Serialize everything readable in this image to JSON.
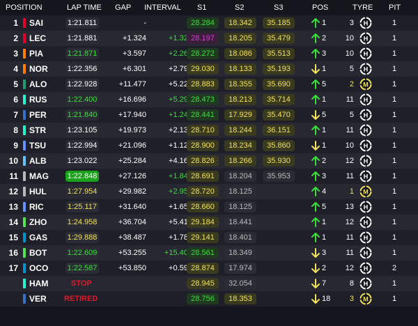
{
  "header": {
    "position": "POSITION",
    "lap_time": "LAP TIME",
    "gap": "GAP",
    "interval": "INTERVAL",
    "s1": "S1",
    "s2": "S2",
    "s3": "S3",
    "pos": "POS",
    "tyre": "TYRE",
    "pit": "PIT"
  },
  "colors": {
    "green": "#3adf3a",
    "red": "#e0192a",
    "yellow": "#f0e15a",
    "purple": "#d33ad3"
  },
  "rows": [
    {
      "pos": "1",
      "team_color": "#e8002d",
      "driver": "SAI",
      "lap": "1:21.811",
      "lap_style": "normal",
      "gap": "-",
      "interval": "-",
      "interval_color": "#ffffff",
      "s1": "28.284",
      "s1c": "g",
      "s2": "18.342",
      "s2c": "y",
      "s3": "35.185",
      "s3c": "y",
      "dir": "up",
      "change": "1",
      "tyre_laps": "3",
      "compound": "H",
      "pit": "1"
    },
    {
      "pos": "2",
      "team_color": "#e8002d",
      "driver": "LEC",
      "lap": "1:21.881",
      "lap_style": "normal",
      "gap": "+1.324",
      "interval": "+1.324",
      "interval_color": "#3adf3a",
      "s1": "28.197",
      "s1c": "p",
      "s2": "18.205",
      "s2c": "y",
      "s3": "35.479",
      "s3c": "y",
      "dir": "up",
      "change": "2",
      "tyre_laps": "10",
      "compound": "H",
      "pit": "1"
    },
    {
      "pos": "3",
      "team_color": "#ff8000",
      "driver": "PIA",
      "lap": "1:21.871",
      "lap_style": "green",
      "gap": "+3.597",
      "interval": "+2.264",
      "interval_color": "#3adf3a",
      "s1": "28.272",
      "s1c": "g",
      "s2": "18.086",
      "s2c": "y",
      "s3": "35.513",
      "s3c": "y",
      "dir": "up",
      "change": "3",
      "tyre_laps": "10",
      "compound": "H",
      "pit": "1"
    },
    {
      "pos": "4",
      "team_color": "#ff8000",
      "driver": "NOR",
      "lap": "1:22.356",
      "lap_style": "normal",
      "gap": "+6.301",
      "interval": "+2.796",
      "interval_color": "#ffffff",
      "s1": "29.030",
      "s1c": "y",
      "s2": "18.133",
      "s2c": "y",
      "s3": "35.193",
      "s3c": "y",
      "dir": "down",
      "change": "1",
      "tyre_laps": "5",
      "compound": "H",
      "pit": "1"
    },
    {
      "pos": "5",
      "team_color": "#229971",
      "driver": "ALO",
      "lap": "1:22.928",
      "lap_style": "normal",
      "gap": "+11.477",
      "interval": "+5.224",
      "interval_color": "#ffffff",
      "s1": "28.883",
      "s1c": "y",
      "s2": "18.355",
      "s2c": "y",
      "s3": "35.690",
      "s3c": "y",
      "dir": "up",
      "change": "5",
      "tyre_laps": "2",
      "compound": "M",
      "pit": "1"
    },
    {
      "pos": "6",
      "team_color": "#27f4d2",
      "driver": "RUS",
      "lap": "1:22.400",
      "lap_style": "green",
      "gap": "+16.696",
      "interval": "+5.295",
      "interval_color": "#3adf3a",
      "s1": "28.473",
      "s1c": "g",
      "s2": "18.213",
      "s2c": "y",
      "s3": "35.714",
      "s3c": "y",
      "dir": "up",
      "change": "1",
      "tyre_laps": "11",
      "compound": "H",
      "pit": "1"
    },
    {
      "pos": "7",
      "team_color": "#3671c6",
      "driver": "PER",
      "lap": "1:21.840",
      "lap_style": "green",
      "gap": "+17.940",
      "interval": "+1.244",
      "interval_color": "#3adf3a",
      "s1": "28.441",
      "s1c": "g",
      "s2": "17.929",
      "s2c": "y",
      "s3": "35.470",
      "s3c": "y",
      "dir": "down",
      "change": "5",
      "tyre_laps": "5",
      "compound": "H",
      "pit": "1"
    },
    {
      "pos": "8",
      "team_color": "#27f4d2",
      "driver": "STR",
      "lap": "1:23.105",
      "lap_style": "normal",
      "gap": "+19.973",
      "interval": "+2.138",
      "interval_color": "#ffffff",
      "s1": "28.710",
      "s1c": "y",
      "s2": "18.244",
      "s2c": "y",
      "s3": "36.151",
      "s3c": "y",
      "dir": "up",
      "change": "1",
      "tyre_laps": "11",
      "compound": "H",
      "pit": "1"
    },
    {
      "pos": "9",
      "team_color": "#6692ff",
      "driver": "TSU",
      "lap": "1:22.994",
      "lap_style": "normal",
      "gap": "+21.096",
      "interval": "+1.123",
      "interval_color": "#ffffff",
      "s1": "28.900",
      "s1c": "y",
      "s2": "18.234",
      "s2c": "y",
      "s3": "35.860",
      "s3c": "y",
      "dir": "down",
      "change": "1",
      "tyre_laps": "10",
      "compound": "H",
      "pit": "1"
    },
    {
      "pos": "10",
      "team_color": "#64c4ff",
      "driver": "ALB",
      "lap": "1:23.022",
      "lap_style": "normal",
      "gap": "+25.284",
      "interval": "+4.163",
      "interval_color": "#ffffff",
      "s1": "28.826",
      "s1c": "y",
      "s2": "18.266",
      "s2c": "y",
      "s3": "35.930",
      "s3c": "y",
      "dir": "up",
      "change": "2",
      "tyre_laps": "12",
      "compound": "H",
      "pit": "1"
    },
    {
      "pos": "11",
      "team_color": "#b6babd",
      "driver": "MAG",
      "lap": "1:22.848",
      "lap_style": "best",
      "gap": "+27.126",
      "interval": "+1.842",
      "interval_color": "#3adf3a",
      "s1": "28.691",
      "s1c": "y",
      "s2": "18.204",
      "s2c": "w",
      "s3": "35.953",
      "s3c": "w",
      "dir": "up",
      "change": "3",
      "tyre_laps": "11",
      "compound": "H",
      "pit": "1"
    },
    {
      "pos": "12",
      "team_color": "#b6babd",
      "driver": "HUL",
      "lap": "1:27.954",
      "lap_style": "yellow",
      "gap": "+29.982",
      "interval": "+2.952",
      "interval_color": "#3adf3a",
      "s1": "28.720",
      "s1c": "y",
      "s2": "18.125",
      "s2c": "w",
      "s3": "",
      "s3c": "none",
      "dir": "up",
      "change": "4",
      "tyre_laps": "1",
      "compound": "M",
      "pit": "1"
    },
    {
      "pos": "13",
      "team_color": "#6692ff",
      "driver": "RIC",
      "lap": "1:25.117",
      "lap_style": "yellow",
      "gap": "+31.640",
      "interval": "+1.658",
      "interval_color": "#ffffff",
      "s1": "28.660",
      "s1c": "y",
      "s2": "18.125",
      "s2c": "w",
      "s3": "",
      "s3c": "none",
      "dir": "up",
      "change": "5",
      "tyre_laps": "13",
      "compound": "H",
      "pit": "1"
    },
    {
      "pos": "14",
      "team_color": "#52e252",
      "driver": "ZHO",
      "lap": "1:24.958",
      "lap_style": "yellow",
      "gap": "+36.704",
      "interval": "+5.415",
      "interval_color": "#ffffff",
      "s1": "29.184",
      "s1c": "y",
      "s2": "18.441",
      "s2c": "w",
      "s3": "",
      "s3c": "none",
      "dir": "up",
      "change": "1",
      "tyre_laps": "12",
      "compound": "H",
      "pit": "1"
    },
    {
      "pos": "15",
      "team_color": "#0093cc",
      "driver": "GAS",
      "lap": "1:29.888",
      "lap_style": "yellow",
      "gap": "+38.487",
      "interval": "+1.783",
      "interval_color": "#ffffff",
      "s1": "29.141",
      "s1c": "y",
      "s2": "18.401",
      "s2c": "w",
      "s3": "",
      "s3c": "none",
      "dir": "up",
      "change": "1",
      "tyre_laps": "11",
      "compound": "H",
      "pit": "1"
    },
    {
      "pos": "16",
      "team_color": "#52e252",
      "driver": "BOT",
      "lap": "1:22.609",
      "lap_style": "green",
      "gap": "+53.255",
      "interval": "+15.402",
      "interval_color": "#3adf3a",
      "s1": "28.561",
      "s1c": "g",
      "s2": "18.349",
      "s2c": "w",
      "s3": "",
      "s3c": "none",
      "dir": "down",
      "change": "3",
      "tyre_laps": "11",
      "compound": "H",
      "pit": "1"
    },
    {
      "pos": "17",
      "team_color": "#0093cc",
      "driver": "OCO",
      "lap": "1:22.587",
      "lap_style": "green",
      "gap": "+53.850",
      "interval": "+0.595",
      "interval_color": "#ffffff",
      "s1": "28.874",
      "s1c": "y",
      "s2": "17.974",
      "s2c": "w",
      "s3": "",
      "s3c": "none",
      "dir": "down",
      "change": "2",
      "tyre_laps": "12",
      "compound": "H",
      "pit": "2"
    },
    {
      "pos": "",
      "team_color": "#27f4d2",
      "driver": "HAM",
      "lap": "STOP",
      "lap_style": "status",
      "gap": "",
      "interval": "",
      "interval_color": "#ffffff",
      "s1": "28.945",
      "s1c": "y",
      "s2": "32.054",
      "s2c": "w",
      "s3": "",
      "s3c": "none",
      "dir": "down",
      "change": "7",
      "tyre_laps": "8",
      "compound": "H",
      "pit": "1"
    },
    {
      "pos": "",
      "team_color": "#3671c6",
      "driver": "VER",
      "lap": "RETIRED",
      "lap_style": "status",
      "gap": "",
      "interval": "",
      "interval_color": "#ffffff",
      "s1": "28.756",
      "s1c": "g",
      "s2": "18.353",
      "s2c": "y",
      "s3": "",
      "s3c": "none",
      "dir": "down",
      "change": "18",
      "tyre_laps": "3",
      "compound": "M",
      "pit": "1"
    }
  ]
}
